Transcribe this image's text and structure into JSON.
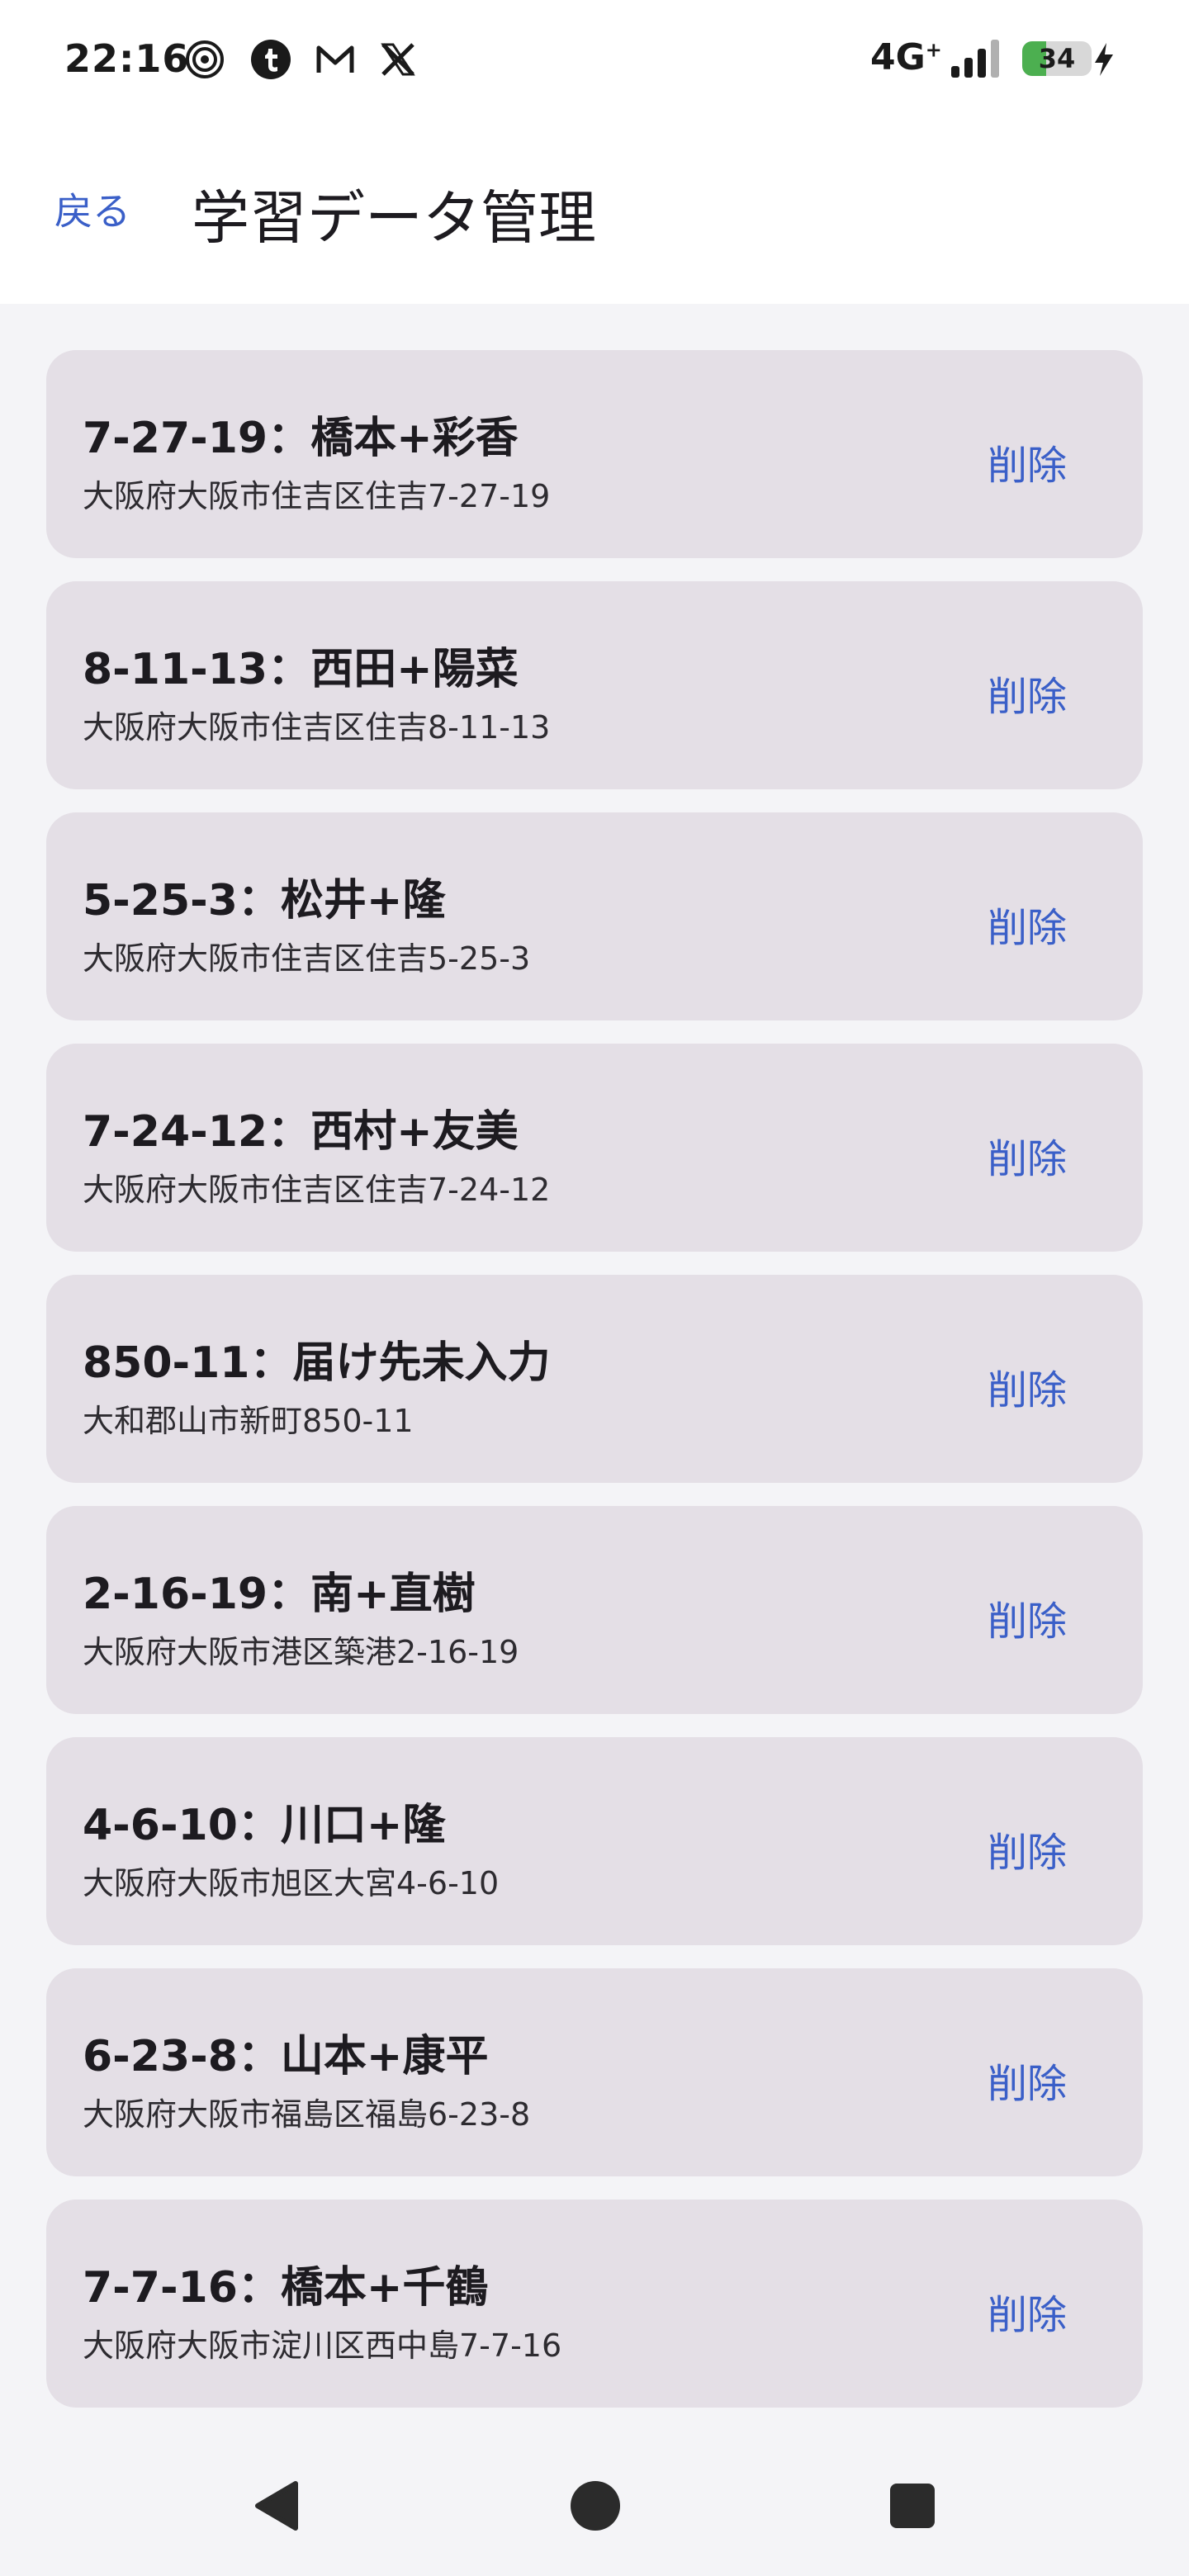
{
  "status_bar": {
    "time": "22:16",
    "icons": [
      "target-icon",
      "tumblr-icon",
      "gmail-icon",
      "x-icon"
    ],
    "network": "4G",
    "network_sup": "+",
    "battery_level": "34",
    "battery_fraction": 0.34,
    "charging": true
  },
  "header": {
    "back_label": "戻る",
    "title": "学習データ管理"
  },
  "entries": [
    {
      "title": "7-27-19：橋本+彩香",
      "address": "大阪府大阪市住吉区住吉7-27-19",
      "delete_label": "削除"
    },
    {
      "title": "8-11-13：西田+陽菜",
      "address": "大阪府大阪市住吉区住吉8-11-13",
      "delete_label": "削除"
    },
    {
      "title": "5-25-3：松井+隆",
      "address": "大阪府大阪市住吉区住吉5-25-3",
      "delete_label": "削除"
    },
    {
      "title": "7-24-12：西村+友美",
      "address": "大阪府大阪市住吉区住吉7-24-12",
      "delete_label": "削除"
    },
    {
      "title": "850-11：届け先未入力",
      "address": "大和郡山市新町850-11",
      "delete_label": "削除"
    },
    {
      "title": "2-16-19：南+直樹",
      "address": "大阪府大阪市港区築港2-16-19",
      "delete_label": "削除"
    },
    {
      "title": "4-6-10：川口+隆",
      "address": "大阪府大阪市旭区大宮4-6-10",
      "delete_label": "削除"
    },
    {
      "title": "6-23-8：山本+康平",
      "address": "大阪府大阪市福島区福島6-23-8",
      "delete_label": "削除"
    },
    {
      "title": "7-7-16：橋本+千鶴",
      "address": "大阪府大阪市淀川区西中島7-7-16",
      "delete_label": "削除"
    }
  ],
  "nav": {
    "icons": [
      "back-triangle-icon",
      "home-circle-icon",
      "recents-square-icon"
    ]
  },
  "colors": {
    "accent": "#3a5fc8",
    "card": "#e4dfe6",
    "list_background": "#f4f4f7",
    "battery": "#4caf50"
  }
}
